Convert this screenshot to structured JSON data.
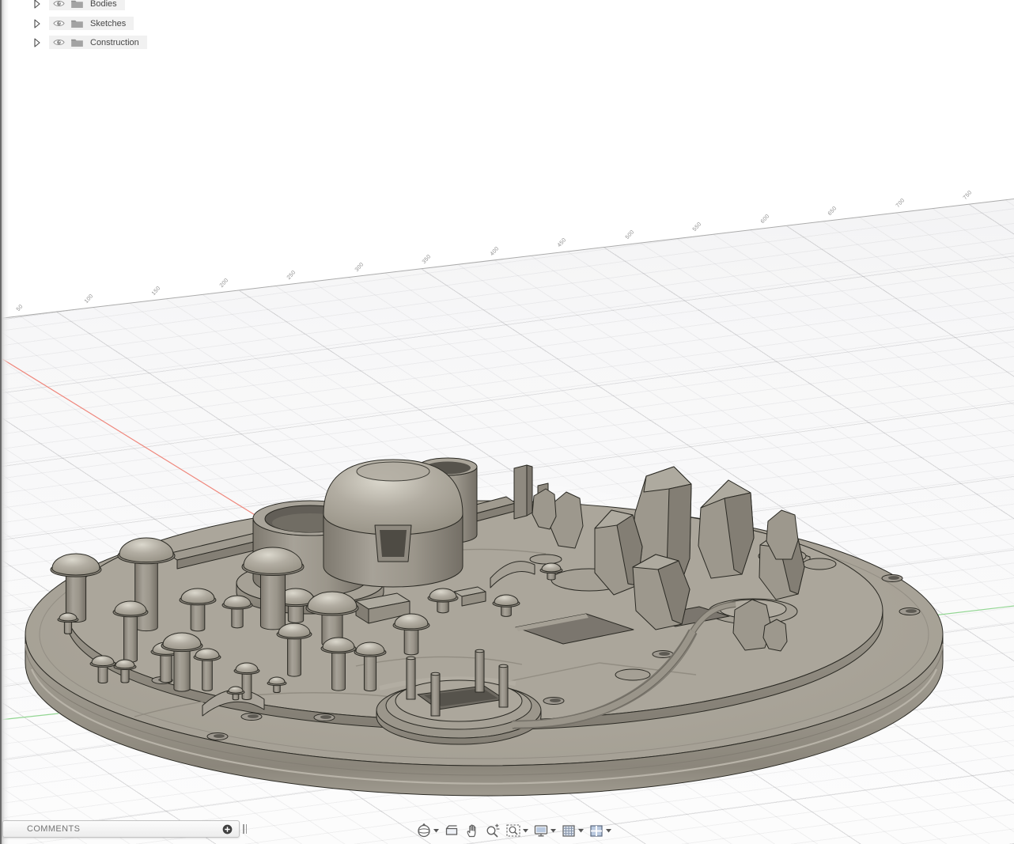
{
  "browser_tree": {
    "items": [
      {
        "label": "Bodies"
      },
      {
        "label": "Sketches"
      },
      {
        "label": "Construction"
      }
    ]
  },
  "comments_bar": {
    "label": "COMMENTS",
    "add_icon": "plus-circle-icon"
  },
  "nav_toolbar": {
    "tools": [
      {
        "name": "orbit",
        "icon": "orbit-icon",
        "has_dropdown": true
      },
      {
        "name": "look-at",
        "icon": "look-at-icon",
        "has_dropdown": false
      },
      {
        "name": "pan",
        "icon": "pan-hand-icon",
        "has_dropdown": false
      },
      {
        "name": "zoom",
        "icon": "zoom-icon",
        "has_dropdown": false
      },
      {
        "name": "fit",
        "icon": "fit-icon",
        "has_dropdown": true
      },
      {
        "name": "display-settings",
        "icon": "display-settings-icon",
        "has_dropdown": true
      },
      {
        "name": "grid-and-snaps",
        "icon": "grid-icon",
        "has_dropdown": true
      },
      {
        "name": "viewports",
        "icon": "viewports-icon",
        "has_dropdown": true
      }
    ]
  },
  "viewport": {
    "ruler_tick_labels": [
      "50",
      "100",
      "150",
      "200",
      "250",
      "300",
      "350",
      "400",
      "450",
      "500",
      "550",
      "600",
      "650",
      "700",
      "750"
    ],
    "axis_colors": {
      "x_axis": "#ef867b",
      "y_axis": "#93d693"
    },
    "model_material_color": "#a8a398",
    "grid_visible": true
  }
}
